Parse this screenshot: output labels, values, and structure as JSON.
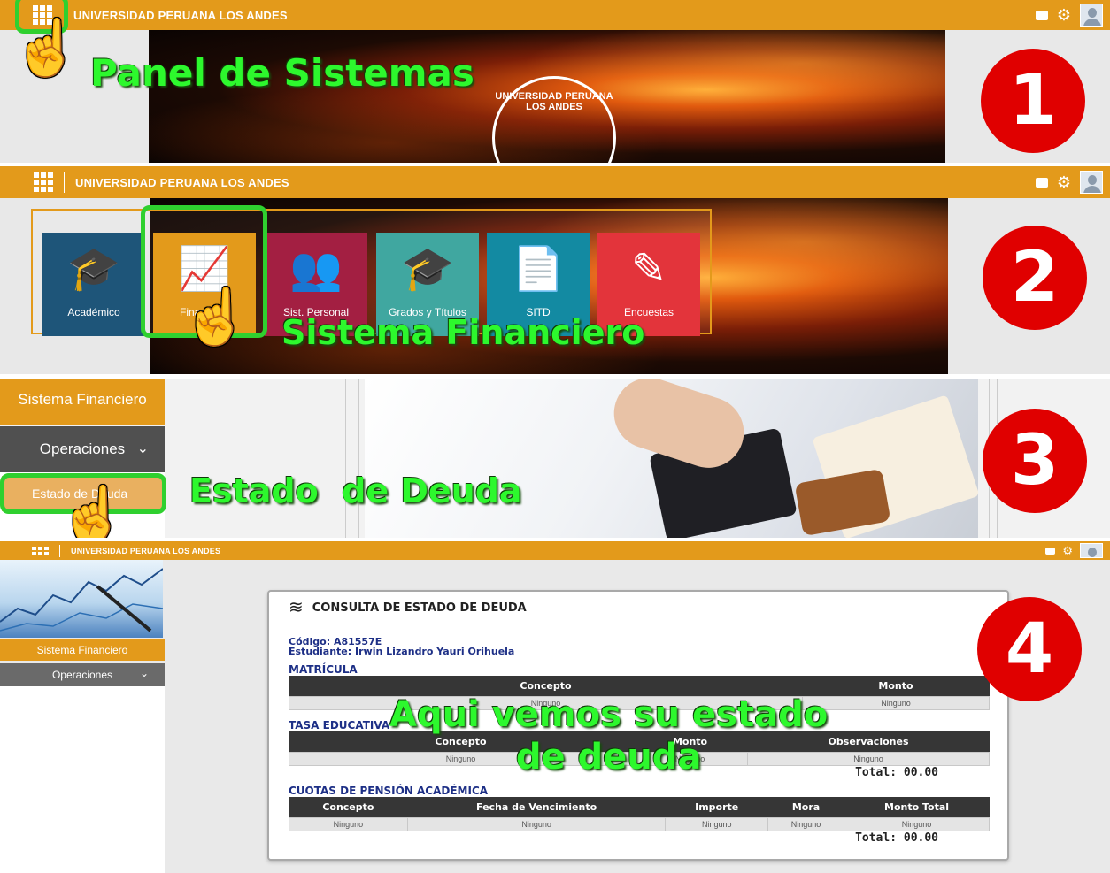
{
  "app": {
    "brand": "UNIVERSIDAD PERUANA LOS ANDES"
  },
  "seal_text": "UNIVERSIDAD PERUANA LOS ANDES",
  "steps": [
    "1",
    "2",
    "3",
    "4"
  ],
  "captions": {
    "panel": "Panel de Sistemas",
    "financiero": "Sistema Financiero",
    "deuda": "Estado  de Deuda",
    "view_line1": "Aqui vemos su estado",
    "view_line2": "de deuda"
  },
  "tiles": [
    {
      "label": "Académico",
      "color": "#1e5579",
      "icon": "graduate-icon"
    },
    {
      "label": "Financiero",
      "color": "#e39a1b",
      "icon": "finance-chart-icon"
    },
    {
      "label": "Sist. Personal",
      "color": "#a31f42",
      "icon": "people-icon"
    },
    {
      "label": "Grados y Títulos",
      "color": "#40a7a0",
      "icon": "grad-cap-icon"
    },
    {
      "label": "SITD",
      "color": "#138aa2",
      "icon": "document-icon"
    },
    {
      "label": "Encuestas",
      "color": "#e3343b",
      "icon": "edit-icon"
    }
  ],
  "sidebar": {
    "title": "Sistema Financiero",
    "menu": "Operaciones",
    "submenu": "Estado de Deuda"
  },
  "debt": {
    "title": "CONSULTA DE ESTADO DE DEUDA",
    "code_label": "Código:",
    "code": "A81557E",
    "student_label": "Estudiante:",
    "student": "Irwin Lizandro Yauri Orihuela",
    "matricula": {
      "title": "MATRÍCULA",
      "headers": [
        "Concepto",
        "Monto"
      ],
      "row": [
        "Ninguno",
        "Ninguno"
      ]
    },
    "tasa": {
      "title": "TASA EDUCATIVA",
      "headers": [
        "Concepto",
        "Monto",
        "Observaciones"
      ],
      "row": [
        "Ninguno",
        "Ninguno",
        "Ninguno"
      ],
      "total": "Total: 00.00"
    },
    "cuotas": {
      "title": "CUOTAS DE PENSIÓN ACADÉMICA",
      "headers": [
        "Concepto",
        "Fecha de Vencimiento",
        "Importe",
        "Mora",
        "Monto Total"
      ],
      "row": [
        "Ninguno",
        "Ninguno",
        "Ninguno",
        "Ninguno",
        "Ninguno"
      ],
      "total": "Total: 00.00"
    }
  }
}
